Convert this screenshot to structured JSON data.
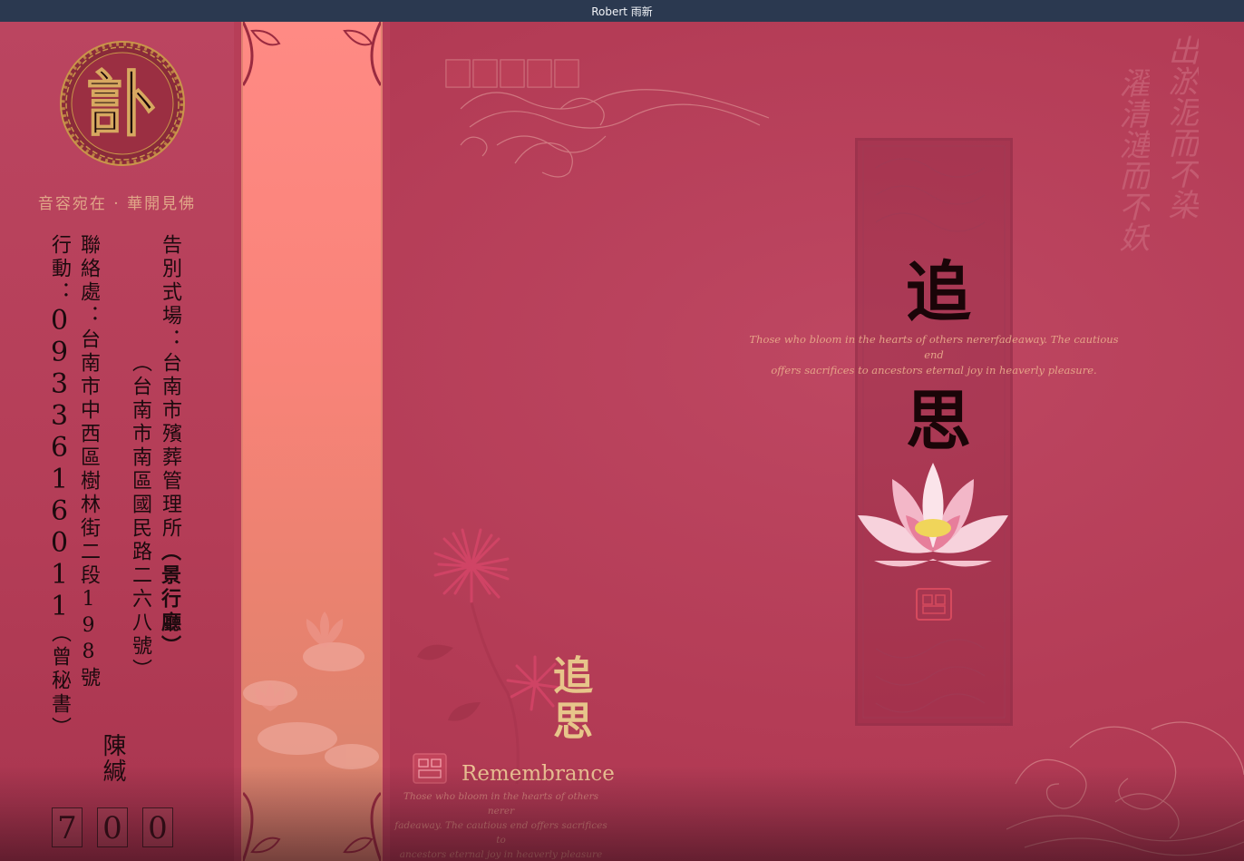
{
  "window": {
    "title": "Robert 雨新"
  },
  "card": {
    "seal_char": "訃",
    "motto": "音容宛在 · 華開見佛",
    "ceremony_label": "告別式場：",
    "ceremony_place": "台南市殯葬管理所",
    "ceremony_hall": "（景行廳）",
    "ceremony_address": "（台南市南區國民路二六八號）",
    "contact_label": "聯絡處：",
    "contact_address": "台南市中西區樹林街二段198號",
    "mobile_label": "行動：",
    "mobile_number": "0933616011",
    "mobile_contact": "（曾秘書）",
    "signer": "陳緘",
    "code_digits": [
      "7",
      "0",
      "0"
    ],
    "title_char_1": "追",
    "title_char_2": "思",
    "quote_line_1": "Those who bloom in the hearts of others nererfadeaway. The cautious end",
    "quote_line_2": "offers sacrifices to ancestors eternal joy in heaverly pleasure.",
    "poem_col_1": "出淤泥而不染",
    "poem_col_2": "濯清漣而不妖",
    "small_char_1": "追",
    "small_char_2": "思",
    "remembrance": "Remembrance",
    "bottom_quote_1": "Those who bloom in the hearts of others nerer",
    "bottom_quote_2": "fadeaway. The cautious end offers sacrifices to",
    "bottom_quote_3": "ancestors eternal joy in heaverly pleasure"
  },
  "colors": {
    "titlebar": "#2b3950",
    "card_red": "#b23a54",
    "band_pink": "#ff8a84",
    "gold": "#e7c58a"
  },
  "icons": {
    "seal": "fret-seal-icon",
    "lotus": "lotus-flower-icon",
    "stamp": "red-stamp-icon",
    "chrysanthemum": "chrysanthemum-icon",
    "phoenix": "phoenix-ornament-icon",
    "clouds": "cloud-scroll-icon"
  }
}
